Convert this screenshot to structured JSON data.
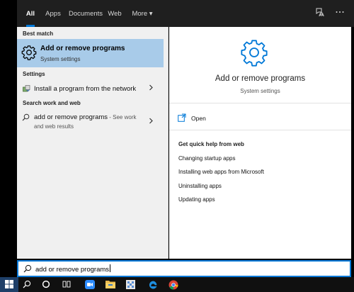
{
  "tabs": [
    {
      "label": "All",
      "active": true
    },
    {
      "label": "Apps"
    },
    {
      "label": "Documents"
    },
    {
      "label": "Web"
    },
    {
      "label": "More"
    }
  ],
  "tab_more_arrow": "▾",
  "toolbar_icons": [
    "feedback-icon",
    "more-options-icon"
  ],
  "left": {
    "best_match_title": "Best match",
    "best_match": {
      "title": "Add or remove programs",
      "subtitle": "System settings",
      "icon": "gear-icon"
    },
    "settings_title": "Settings",
    "settings_item": {
      "label": "Install a program from the network",
      "icon": "install-program-icon"
    },
    "web_title": "Search work and web",
    "web_item": {
      "label": "add or remove programs",
      "suffix": " - See work",
      "line2": "and web results",
      "icon": "search-icon"
    }
  },
  "right": {
    "title": "Add or remove programs",
    "subtitle": "System settings",
    "open_label": "Open",
    "help_title": "Get quick help from web",
    "help_links": [
      "Changing startup apps",
      "Installing web apps from Microsoft",
      "Uninstalling apps",
      "Updating apps"
    ]
  },
  "search": {
    "query": "add or remove programs"
  },
  "colors": {
    "accent": "#0078d7",
    "selection": "#a8cbe9"
  },
  "taskbar": [
    "windows-start-icon",
    "search-icon",
    "cortana-icon",
    "task-view-icon",
    "zoom-icon",
    "file-explorer-icon",
    "app-icon",
    "edge-icon",
    "chrome-icon"
  ]
}
